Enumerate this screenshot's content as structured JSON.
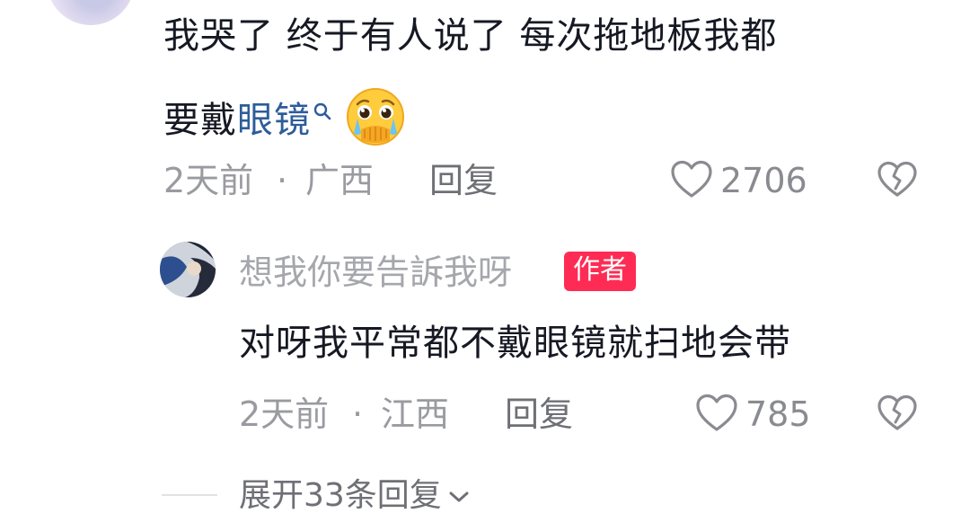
{
  "top_comment": {
    "text_line1": "我哭了 终于有人说了 每次拖地板我都",
    "text_line2_prefix": "要戴",
    "linked_keyword": "眼镜",
    "search_icon": "search-icon",
    "emoji": "crying-covering-mouth-emoji",
    "time": "2天前",
    "location": "广西",
    "separator": "·",
    "reply_label": "回复",
    "like_count": "2706",
    "like_icon": "heart-outline-icon",
    "dislike_icon": "broken-heart-icon"
  },
  "reply_comment": {
    "username": "想我你要告訴我呀",
    "author_badge": "作者",
    "text": "对呀我平常都不戴眼镜就扫地会带",
    "time": "2天前",
    "location": "江西",
    "separator": "·",
    "reply_label": "回复",
    "like_count": "785",
    "like_icon": "heart-outline-icon",
    "dislike_icon": "broken-heart-icon"
  },
  "expand_replies": {
    "label": "展开33条回复",
    "icon": "chevron-down-icon"
  },
  "colors": {
    "text_primary": "#161823",
    "text_secondary": "#9a9ba0",
    "link": "#2e5c9a",
    "author_badge_bg": "#fe2c55"
  }
}
